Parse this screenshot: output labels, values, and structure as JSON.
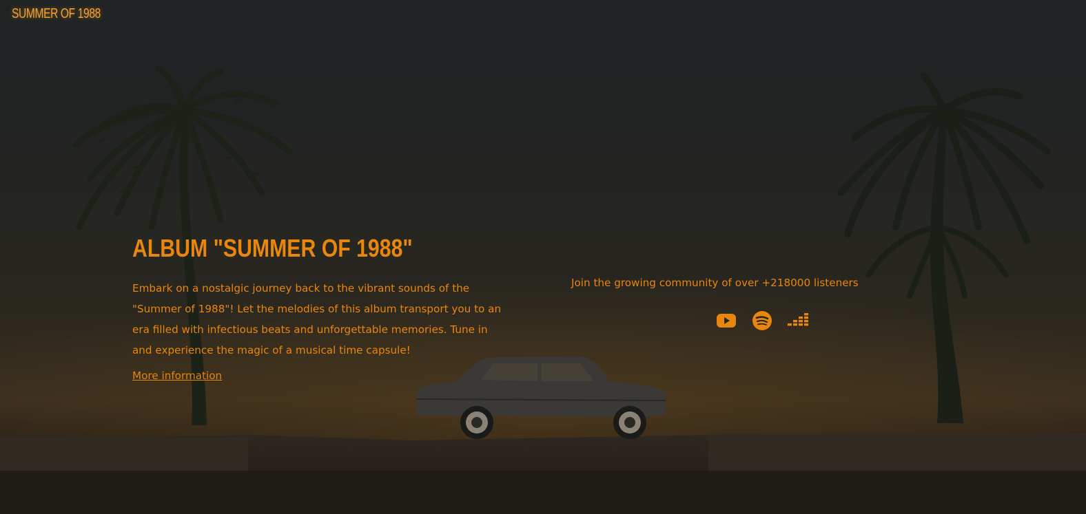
{
  "header": {
    "logo_text": "SUMMER OF 1988"
  },
  "hero": {
    "title": "ALBUM \"SUMMER OF 1988\"",
    "description": "Embark on a nostalgic journey back to the vibrant sounds of the \"Summer of 1988\"! Let the melodies of this album transport you to an era filled with infectious beats and unforgettable memories. Tune in and experience the magic of a musical time capsule!",
    "more_link_label": "More information"
  },
  "community": {
    "text": "Join the growing community of over +218000 listeners",
    "social_icons": [
      "youtube-icon",
      "spotify-icon",
      "deezer-icon"
    ]
  },
  "colors": {
    "accent": "#e8860e",
    "logo": "#f0a334",
    "background_dark": "#222524"
  }
}
